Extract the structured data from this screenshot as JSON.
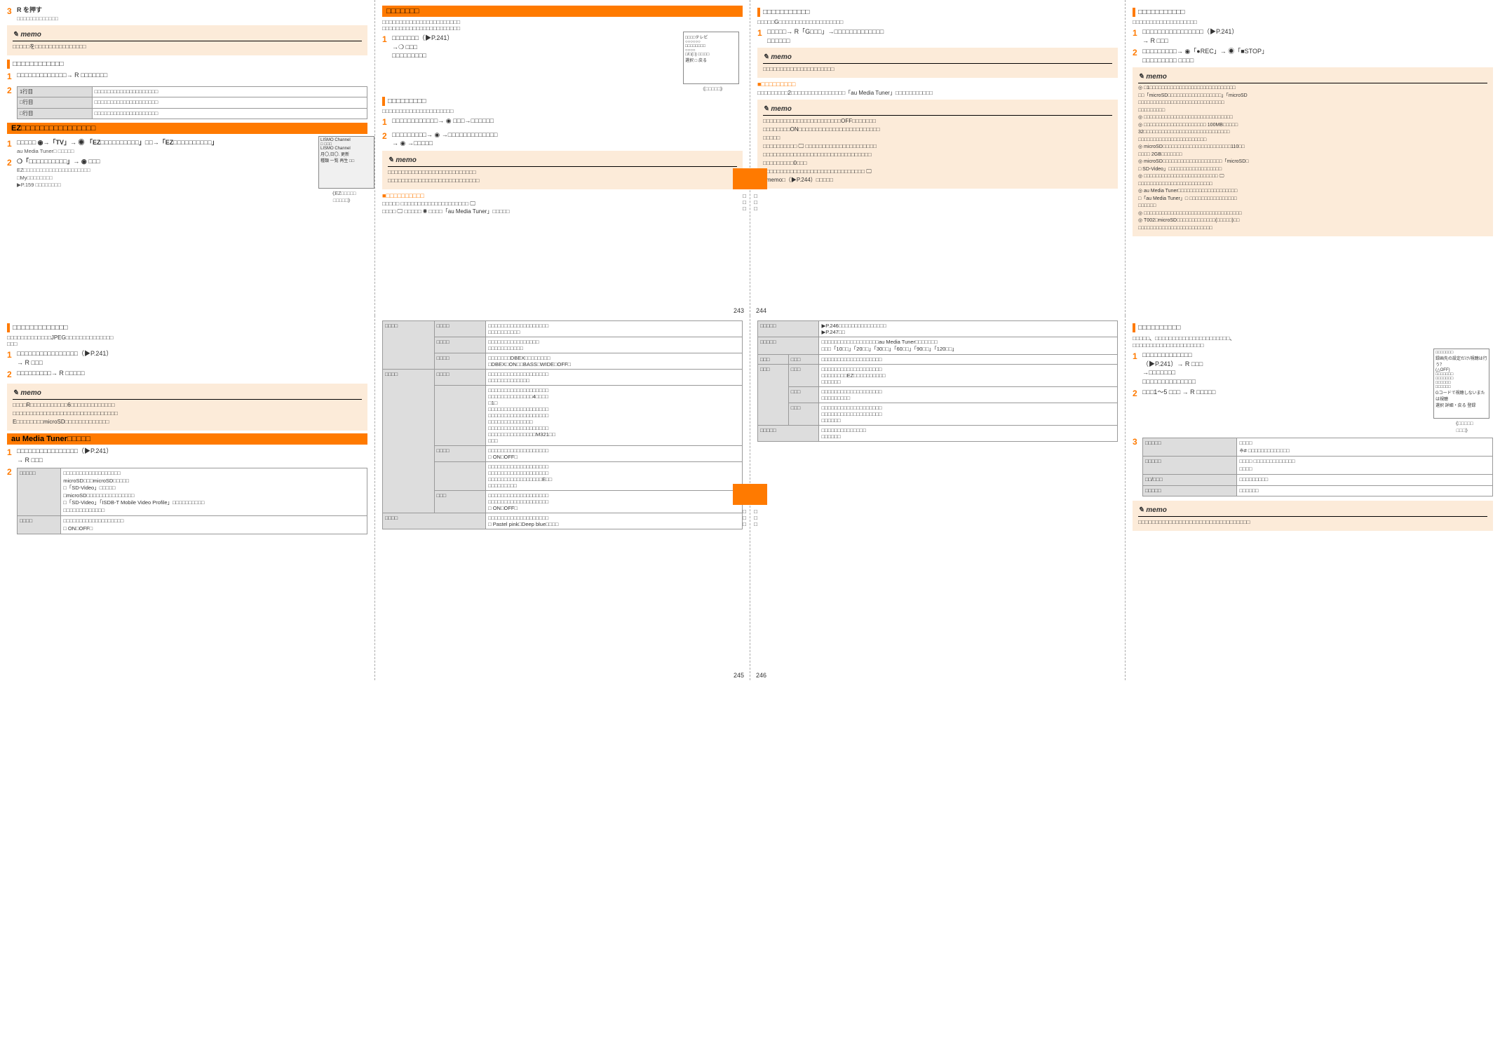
{
  "spread1": {
    "p1": {
      "step3": "R を押す",
      "step3sub": "□□□□□□□□□□□□□",
      "memo1": "□□□□□を□□□□□□□□□□□□□□□",
      "sub1": "□□□□□□□□□□□□",
      "s1": "□□□□□□□□□□□□□→ R □□□□□□□",
      "tbl1": {
        "r1": [
          "1行目",
          "□□□□□□□□□□□□□□□□□□□□"
        ],
        "r2": [
          "□行目",
          "□□□□□□□□□□□□□□□□□□□□"
        ],
        "r3": [
          "□行目",
          "□□□□□□□□□□□□□□□□□□□□"
        ]
      },
      "ez_title": "EZ□□□□□□□□□□□□□□□□",
      "ez1": "□□□□□ ◉→「TV」→ ◉ 「EZ□□□□□□□□□□」□□→「EZ□□□□□□□□□□」",
      "ez1sub": "au Media Tuner□ □□□□□",
      "ez2": "❍「□□□□□□□□□□」→ ◉ □□□",
      "ez2sub": "EZ□□□□□□□□□□□□□□□□□□□□□\n□My□□□□□□□□\n▶P.159 □□□□□□□□",
      "ez_caption": "《EZ□□□□□\n□□□□□》",
      "ez_screen": "LISMO Channel\n□ □□□\nLISMO Channel\n月〇,日〇. 更新\n種類 一覧 再生 □□"
    },
    "p2": {
      "sec": "□□□□□□□",
      "body": "□□□□□□□□□□□□□□□□□□□□□□□\n□□□□□□□□□□□□□□□□□□□□□□□",
      "s1": "□□□□□□□（▶P.241）\n→❍ □□□\n□□□□□□□□□",
      "screen_caption": "《□□□□□》",
      "screen_text": "□□□□テレビ\n○○○○○○\n□□□□□□□□\n○○○○\n□/□(□) □□:□□\n選択  □  戻る",
      "sub2": "□□□□□□□□□",
      "body2": "□□□□□□□□□□□□□□□□□□□□□",
      "s2_1": "□□□□□□□□□□□□→ ◉ □□□→□□□□□□",
      "s2_2": "□□□□□□□□□→ ◉ →□□□□□□□□□□□□□\n→ ◉ →□□□□□",
      "memo2": "□□□□□□□□□□□□□□□□□□□□□□□□□□\n□□□□□□□□□□□□□□□□□□□□□□□□□□□",
      "red": "■□□□□□□□□□□",
      "body3": "□□□□□ □□□□□□□□□□□□□□□□□□□□ 🖵\n□□□□ 🖵 □□□□□ ◉ □□□□「au Media Tuner」□□□□□",
      "pnum": "243"
    },
    "p3": {
      "sub1": "□□□□□□□□□□□",
      "body1": "□□□□□G□□□□□□□□□□□□□□□□□□□",
      "s1": "□□□□□→ R「G□□□」→□□□□□□□□□□□□□\n□□□□□□",
      "memo1": "□□□□□□□□□□□□□□□□□□□□□",
      "red": "■□□□□□□□□□",
      "body2": "□□□□□□□□□2□□□□□□□□□□□□□□□□「au Media Tuner」□□□□□□□□□□□\n",
      "memo2": "□□□□□□□□□□□□□□□□□□□□□□□OFF□□□□□□□\n□□□□□□□□ON□□□□□□□□□□□□□□□□□□□□□□□□\n□□□□□\n□□□□□□□□□□ 🖵 □□□□□□□□□□□□□□□□□□□□□\n□□□□□□□□□□□□□□□□□□□□□□□□□□□□□□□□\n□□□□□□□□□0□□□\n□□□□□□□□□□□□□□□□□□□□□□□□□□□□□□ 🖵\n□memo□（▶P.244）□□□□□",
      "pnum": "244"
    },
    "p4": {
      "sub1": "□□□□□□□□□□□",
      "body1": "□□□□□□□□□□□□□□□□□□□",
      "s1": "□□□□□□□□□□□□□□□□（▶P.241）\n→ R □□□",
      "s2": "□□□□□□□□□→ ◉「●REC」→ ◉「■STOP」\n□□□□□□□□□ □□□□",
      "memo": "◎ □1□□□□□□□□□□□□□□□□□□□□□□□□□□□□□\n□□「microSD□□□□□□□□□□□□□□□□□□」「microSD\n□□□□□□□□□□□□□□□□□□□□□□□□□□□□□\n□□□□□□□□□\n◎ □□□□□□□□□□□□□□□□□□□□□□□□□□□□□□\n◎ □□□□□□□□□□□□□□□□□□□□□ 100MB□□□□□\n32□□□□□□□□□□□□□□□□□□□□□□□□□□□□□\n□□□□□□□□□□□□□□□□□□□□□□□\n◎ microSD□□□□□□□□□□□□□□□□□□□□□□□110□□\n□□□□ 2GB□□□□□□□\n◎ microSD□□□□□□□□□□□□□□□□□□□□「microSD□\n□ SD-Video」□□□□□□□□□□□□□□□□□□\n◎ □□□□□□□□□□□□□□□□□□□□□□□□□ 🖵\n□□□□□□□□□□□□□□□□□□□□□□□□□\n◎ au Media Tuner□□□□□□□□□□□□□□□□□□□□\n□「au Media Tuner」□ □□□□□□□□□□□□□□□□\n□□□□□□\n◎ □□□□□□□□□□□□□□□□□□□□□□□□□□□□□□□□□\n◎ T002□microSD□□□□□□□□□□□□□(□□□□□)□□\n□□□□□□□□□□□□□□□□□□□□□□□□□"
    }
  },
  "spread2": {
    "p1": {
      "sub1": "□□□□□□□□□□□□□",
      "body1": "□□□□□□□□□□□□□JPEG□□□□□□□□□□□□□□\n□□□",
      "s1": "□□□□□□□□□□□□□□□□（▶P.241）\n→ R □□□",
      "s2": "□□□□□□□□□→ R □□□□□",
      "memo1": "□□□□R□□□□□□□□□□□6□□□□□□□□□□□□□\n□□□□□□□□□□□□□□□□□□□□□□□□□□□□□□□\nE□□□□□□□□microSD□□□□□□□□□□□□□",
      "au_title": "au Media Tuner□□□□□",
      "au_s1": "□□□□□□□□□□□□□□□□（▶P.241）\n→ R □□□",
      "tbl": {
        "r1": [
          "□□□□□",
          "□□□□□□□□□□□□□□□□□□\nmicroSD□□□microSD□□□□□\n□「SD-Video」□□□□□\n□microSD□□□□□□□□□□□□□□□\n□「SD-Video」「ISDB-T Mobile Video Profile」□□□□□□□□□□\n□□□□□□□□□□□□□"
        ],
        "r2": [
          "□□□□",
          "□□□□□□□□□□□□□□□□□□□\n□ ON□OFF□"
        ]
      }
    },
    "p2": {
      "tbl": [
        [
          "□□□□",
          "□□□□",
          "□□□□□□□□□□□□□□□□□□□\n□□□□□□□□□□"
        ],
        [
          "",
          "□□□□",
          "□□□□□□□□□□□□□□□□\n□□□□□□□□□□□"
        ],
        [
          "",
          "□□□□",
          "□□□□□□□DBEX□□□□□□□□\n□DBEX□ON□□BASS□WIDE□OFF□"
        ],
        [
          "□□□□",
          "□□□□",
          "□□□□□□□□□□□□□□□□□□□\n□□□□□□□□□□□□□"
        ],
        [
          "",
          "",
          "□□□□□□□□□□□□□□□□□□□\n□□□□□□□□□□□□□□4□□□□\n□1□\n□□□□□□□□□□□□□□□□□□□\n□□□□□□□□□□□□□□□□□□□\n□□□□□□□□□□□□□□\n□□□□□□□□□□□□□□□□□□□\n□□□□□□□□□□□□□□□M321□□\n□□□"
        ],
        [
          "",
          "□□□□",
          "□□□□□□□□□□□□□□□□□□□\n□ ON□OFF□"
        ],
        [
          "",
          "",
          "□□□□□□□□□□□□□□□□□□□\n□□□□□□□□□□□□□□□□□□□\n□□□□□□□□□□□□□□□□□E□□\n□□□□□□□□□"
        ],
        [
          "",
          "□□□",
          "□□□□□□□□□□□□□□□□□□□\n□□□□□□□□□□□□□□□□□□□\n□ ON□OFF□"
        ],
        [
          "□□□□",
          "",
          "□□□□□□□□□□□□□□□□□□□\n□ Pastel pink□Deep blue□□□□"
        ]
      ],
      "pnum": "245"
    },
    "p3": {
      "tbl": [
        [
          "□□□□□",
          "",
          "▶P.246□□□□□□□□□□□□□□□\n▶P.247□□"
        ],
        [
          "□□□□□",
          "",
          "□□□□□□□□□□□□□□□□□□au Media Tuner□□□□□□□\n□□□「10□□」「20□□」「30□□」「60□□」「90□□」「120□□」"
        ],
        [
          "□□□",
          "□□□",
          "□□□□□□□□□□□□□□□□□□□"
        ],
        [
          "□□□",
          "□□□",
          "□□□□□□□□□□□□□□□□□□□\n□□□□□□□□EZ□□□□□□□□□□\n□□□□□□"
        ],
        [
          "",
          "□□□",
          "□□□□□□□□□□□□□□□□□□□\n□□□□□□□□□"
        ],
        [
          "",
          "□□□",
          "□□□□□□□□□□□□□□□□□□□\n□□□□□□□□□□□□□□□□□□□\n□□□□□□"
        ],
        [
          "□□□□□",
          "",
          "□□□□□□□□□□□□□□\n□□□□□□"
        ]
      ],
      "pnum": "246"
    },
    "p4": {
      "sub1": "□□□□□□□□□□",
      "body1": "□□□□□、□□□□□□□□□□□□□□□□□□□□□□、\n□□□□□□□□□□□□□□□□□□□□□",
      "s1": "□□□□□□□□□□□□□\n（▶P.241）→ R □□□\n→□□□□□□□\n□□□□□□□□□□□□□□",
      "s2": "□□□1～5 □□□ → R □□□□□",
      "screen_caption": "《□□□□□\n□□□》",
      "screen_text": "□□□□□□□\n録画先の設定だけ/視聴は行う？\n(△OFF)\n□□□□□□□\n□□□□□□□\n□□□□□□\n□□□□□□\nGコードで視聴しないまたは視聴\n選択  詳細・戻る  登録",
      "tbl": [
        [
          "□□□□□",
          "□□□□\n※# □□□□□□□□□□□□□"
        ],
        [
          "□□□□□",
          "□□□□ □□□□□□□□□□□□□\n□□□□"
        ],
        [
          "□□/□□□",
          "□□□□□□□□□"
        ],
        [
          "□□□□□",
          "□□□□□□"
        ]
      ],
      "memo": "□□□□□□□□□□□□□□□□□□□□□□□□□□□□□□□□□"
    }
  }
}
